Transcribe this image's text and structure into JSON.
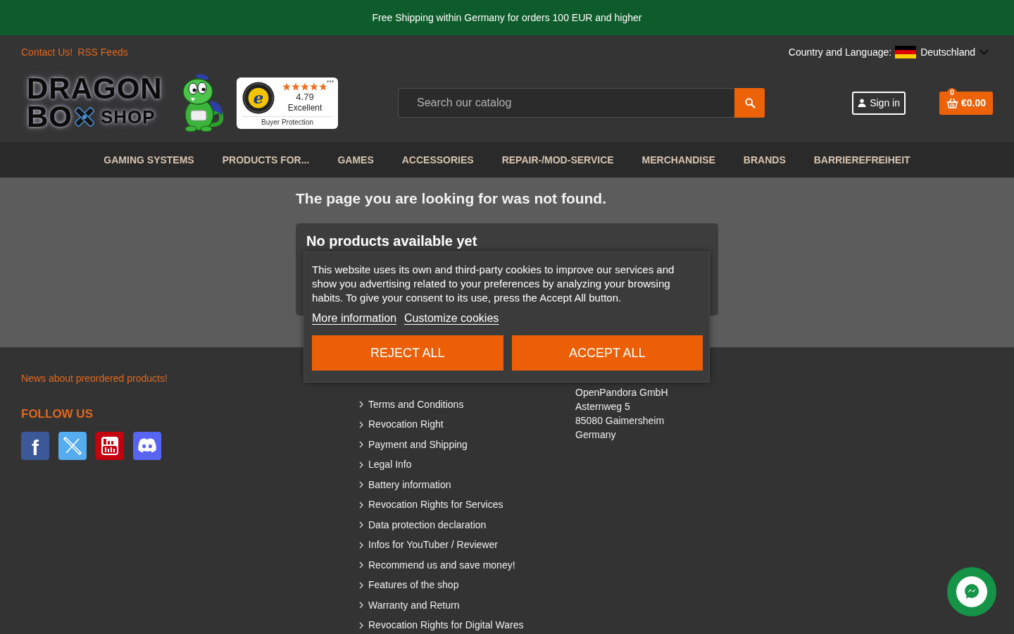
{
  "promo_bar": {
    "text": "Free Shipping within Germany for orders 100 EUR and higher"
  },
  "header": {
    "links": [
      "Contact Us!",
      "RSS Feeds"
    ],
    "locale": {
      "label": "Country and Language:",
      "country": "Deutschland"
    },
    "logo": {
      "top": "DRAGON",
      "bottom": "BO",
      "suffix": "SHOP"
    },
    "trust_badge": {
      "seal_letter": "e",
      "stars": 4.79,
      "rating": "4.79",
      "verdict": "Excellent",
      "caption": "Buyer Protection"
    },
    "search": {
      "placeholder": "Search our catalog"
    },
    "sign_in": {
      "label": "Sign in"
    },
    "cart": {
      "count": "0",
      "total": "€0.00"
    }
  },
  "nav": [
    "GAMING SYSTEMS",
    "PRODUCTS FOR...",
    "GAMES",
    "ACCESSORIES",
    "REPAIR-/MOD-SERVICE",
    "MERCHANDISE",
    "BRANDS",
    "BARRIEREFREIHEIT"
  ],
  "main": {
    "title": "The page you are looking for was not found.",
    "card": {
      "title": "No products available yet"
    }
  },
  "footer": {
    "news_link": "News about preordered products!",
    "follow_heading": "FOLLOW US",
    "social": [
      {
        "kind": "facebook",
        "color": "#3b5998",
        "glyph": "f"
      },
      {
        "kind": "x",
        "color": "#55acee"
      },
      {
        "kind": "youtube",
        "color": "#c4000f"
      },
      {
        "kind": "discord",
        "color": "#5865f2"
      }
    ],
    "info_links": [
      "Terms and Conditions",
      "Revocation Right",
      "Payment and Shipping",
      "Legal Info",
      "Battery information",
      "Revocation Rights for Services",
      "Data protection declaration",
      "Infos for YouTuber / Reviewer",
      "Recommend us and save money!",
      "Features of the shop",
      "Warranty and Return",
      "Revocation Rights for Digital Wares"
    ],
    "address": [
      "OpenPandora GmbH",
      "Asternweg 5",
      "85080 Gaimersheim",
      "Germany"
    ]
  },
  "cookie_banner": {
    "text": "This website uses its own and third-party cookies to improve our services and show you advertising related to your preferences by analyzing your browsing habits. To give your consent to its use, press the Accept All button.",
    "links": [
      "More information",
      "Customize cookies"
    ],
    "buttons": [
      "REJECT ALL",
      "ACCEPT ALL"
    ]
  }
}
